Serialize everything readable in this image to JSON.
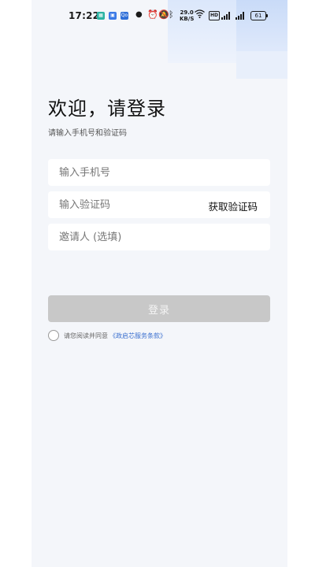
{
  "status_bar": {
    "time": "17:22",
    "net_speed_value": "29.0",
    "net_speed_unit": "KB/S",
    "hd_label": "HD",
    "battery_level": "61",
    "app_badges": [
      {
        "name": "app-badge-teal",
        "color": "#2bb3a3"
      },
      {
        "name": "app-badge-blue",
        "color": "#3b7ae6"
      },
      {
        "name": "app-badge-blue2",
        "color": "#2f6fd8"
      }
    ]
  },
  "login": {
    "title": "欢迎，请登录",
    "subtitle": "请输入手机号和验证码",
    "phone_placeholder": "输入手机号",
    "code_placeholder": "输入验证码",
    "get_code_label": "获取验证码",
    "inviter_placeholder": "邀请人 (选填)",
    "submit_label": "登录",
    "agree_text": "请您阅读并同意",
    "agree_link": "《政启芯服务条款》"
  },
  "colors": {
    "background": "#f4f6fa",
    "button_disabled": "#c8c8c8",
    "link": "#3a6fcf"
  }
}
